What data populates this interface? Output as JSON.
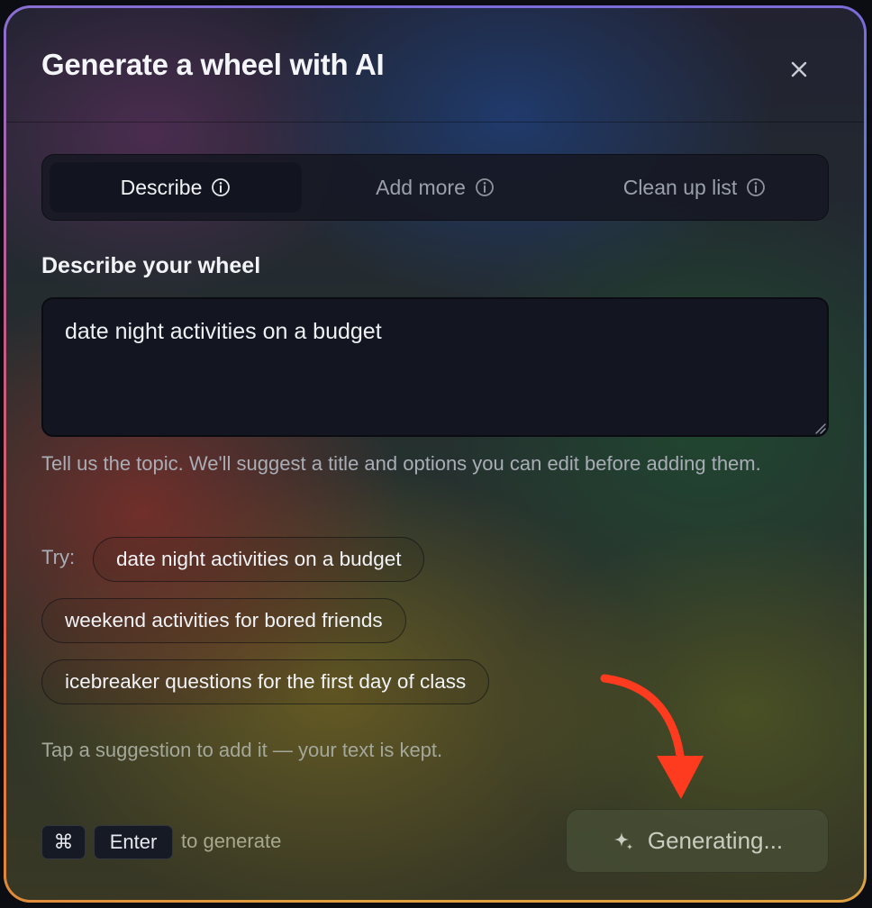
{
  "dialog": {
    "title": "Generate a wheel with AI",
    "close_icon": "close-icon"
  },
  "tabs": [
    {
      "label": "Describe",
      "active": true,
      "icon": "info-icon"
    },
    {
      "label": "Add more",
      "active": false,
      "icon": "info-icon"
    },
    {
      "label": "Clean up list",
      "active": false,
      "icon": "info-icon"
    }
  ],
  "describe": {
    "label": "Describe your wheel",
    "value": "date night activities on a budget",
    "helper": "Tell us the topic. We'll suggest a title and options you can edit before adding them."
  },
  "suggestions": {
    "try_label": "Try:",
    "items": [
      "date night activities on a budget",
      "weekend activities for bored friends",
      "icebreaker questions for the first day of class"
    ],
    "hint": "Tap a suggestion to add it — your text is kept."
  },
  "footer": {
    "kbd_cmd": "⌘",
    "kbd_enter": "Enter",
    "shortcut_text": "to generate",
    "generate_label": "Generating...",
    "generate_icon": "sparkle-icon"
  },
  "colors": {
    "annotation_arrow": "#ff3b1f",
    "tab_active_bg": "#121520",
    "textarea_bg": "#131620"
  }
}
